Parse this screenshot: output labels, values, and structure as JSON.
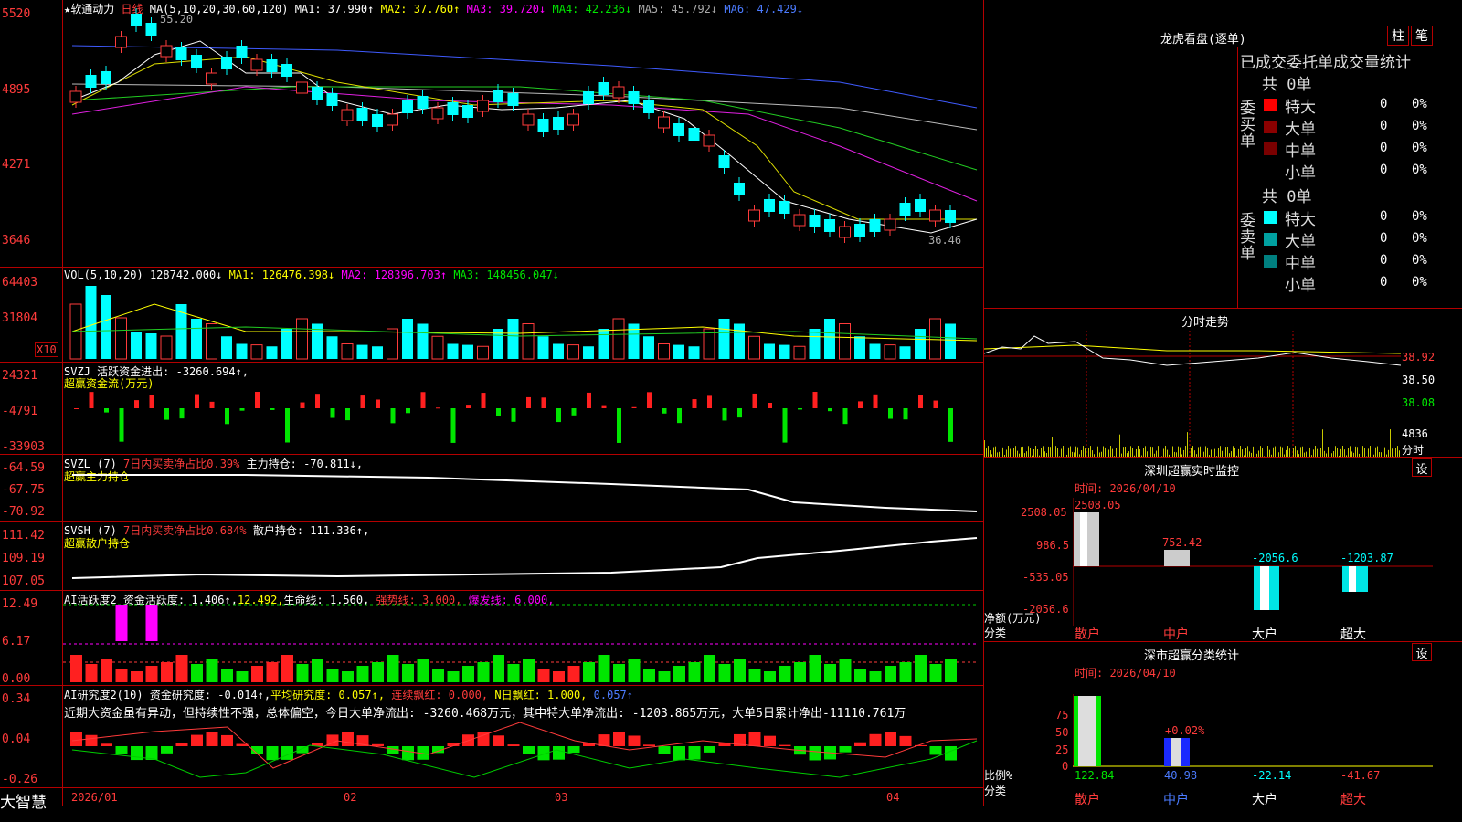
{
  "header": {
    "star": "★",
    "stock": "软通动力",
    "period": "日线",
    "ma_label": "MA(5,10,20,30,60,120)",
    "ma1": "MA1: 37.990↑",
    "ma2": "MA2: 37.760↑",
    "ma3": "MA3: 39.720↓",
    "ma4": "MA4: 42.236↓",
    "ma5": "MA5: 45.792↓",
    "ma6": "MA6: 47.429↓",
    "high": "55.20",
    "low": "36.46"
  },
  "price_axis": [
    "5520",
    "4895",
    "4271",
    "3646"
  ],
  "vol": {
    "label": "VOL(5,10,20)",
    "val": "128742.000↓",
    "ma1": "MA1: 126476.398↓",
    "ma2": "MA2: 128396.703↑",
    "ma3": "MA3: 148456.047↓",
    "axis": [
      "64403",
      "31804"
    ],
    "unit": "X10"
  },
  "svzj": {
    "label": "SVZJ",
    "text": "活跃资金进出: -3260.694↑,",
    "sub": "超赢资金流(万元)",
    "axis": [
      "24321",
      "-4791",
      "-33903"
    ]
  },
  "svzl": {
    "label": "SVZL (7)",
    "a": "7日内买卖净占比0.39%",
    "b": "主力持仓: -70.811↓,",
    "sub": "超赢主力持仓",
    "axis": [
      "-64.59",
      "-67.75",
      "-70.92"
    ]
  },
  "svsh": {
    "label": "SVSH (7)",
    "a": "7日内买卖净占比0.684%",
    "b": "散户持仓: 111.336↑,",
    "sub": "超赢散户持仓",
    "axis": [
      "111.42",
      "109.19",
      "107.05"
    ]
  },
  "ai1": {
    "label": "AI活跃度2",
    "a": "资金活跃度: 1.406↑,",
    "b": "12.492,",
    "c": "生命线: 1.560,",
    "d": "强势线: 3.000,",
    "e": "爆发线: 6.000,",
    "axis": [
      "12.49",
      "6.17",
      "0.00"
    ]
  },
  "ai2": {
    "label": "AI研究度2(10)",
    "a": "资金研究度: -0.014↑,",
    "b": "平均研究度: 0.057↑,",
    "c": "连续飘红: 0.000,",
    "d": "N日飘红: 1.000,",
    "e": "0.057↑",
    "axis": [
      "0.34",
      "0.04",
      "-0.26"
    ],
    "note": "近期大资金虽有异动，但持续性不强，总体偏空，今日大单净流出: -3260.468万元，其中特大单净流出: -1203.865万元，大单5日累计净出-11110.761万"
  },
  "dates": [
    "2026/01",
    "02",
    "03",
    "04"
  ],
  "brand": "大智慧",
  "right": {
    "title": "龙虎看盘(逐单)",
    "btn1": "柱",
    "btn2": "笔",
    "stat_title": "已成交委托单成交量统计",
    "buy_total": "共 0单",
    "sell_total": "共 0单",
    "buy_side": "委买单",
    "sell_side": "委卖单",
    "rows": [
      "特大",
      "大单",
      "中单",
      "小单"
    ],
    "zero": "0",
    "pct": "0%",
    "fs_title": "分时走势",
    "fs_prices": [
      "38.92",
      "38.50",
      "38.08"
    ],
    "fs_vol": "4836",
    "fs_unit": "分时",
    "mon_title": "深圳超赢实时监控",
    "mon_btn": "设",
    "mon_time": "时间: 2026/04/10",
    "mon_axis": [
      "2508.05",
      "986.5",
      "-535.05",
      "-2056.6"
    ],
    "mon_vals": [
      "2508.05",
      "752.42",
      "-2056.6",
      "-1203.87"
    ],
    "mon_ylab": "净额(万元)",
    "mon_xlab": "分类",
    "cls": [
      "散户",
      "中户",
      "大户",
      "超大"
    ],
    "stat2_title": "深市超赢分类统计",
    "stat2_btn": "设",
    "stat2_time": "时间: 2026/04/10",
    "stat2_axis": [
      "75",
      "50",
      "25",
      "0"
    ],
    "stat2_pct": "+0.02%",
    "stat2_ylab": "比例%",
    "stat2_xlab": "分类",
    "stat2_vals": [
      "122.84",
      "40.98",
      "-22.14",
      "-41.67"
    ]
  }
}
